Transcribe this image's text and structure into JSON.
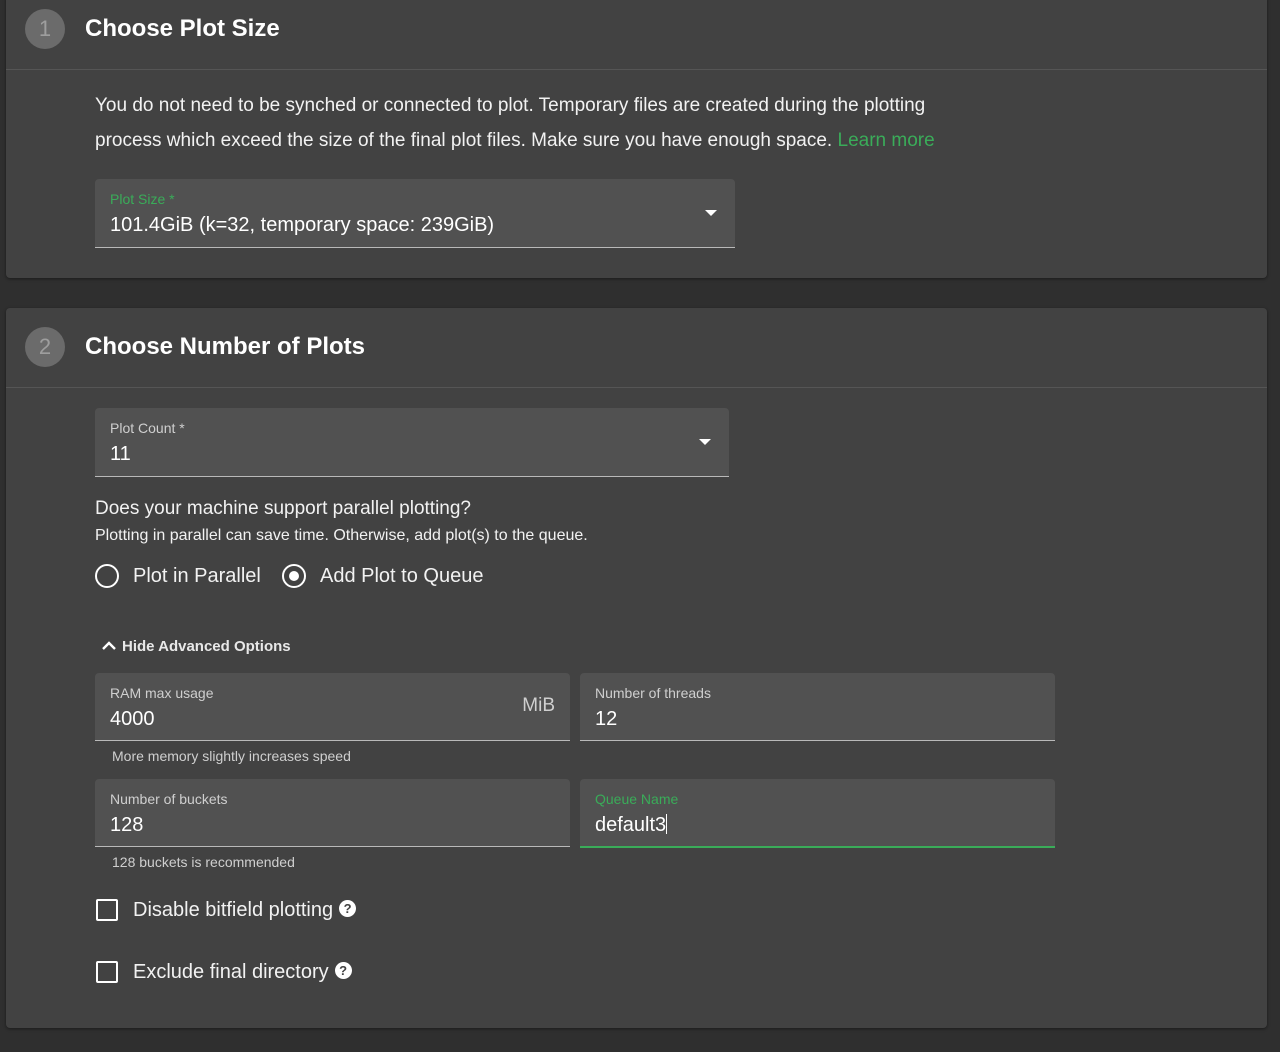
{
  "step1": {
    "number": "1",
    "title": "Choose Plot Size",
    "description": "You do not need to be synched or connected to plot. Temporary files are created during the plotting process which exceed the size of the final plot files. Make sure you have enough space.",
    "learn_more": "Learn more",
    "plot_size_label": "Plot Size *",
    "plot_size_value": "101.4GiB (k=32, temporary space: 239GiB)"
  },
  "step2": {
    "number": "2",
    "title": "Choose Number of Plots",
    "plot_count_label": "Plot Count *",
    "plot_count_value": "11",
    "parallel_question": "Does your machine support parallel plotting?",
    "parallel_hint": "Plotting in parallel can save time. Otherwise, add plot(s) to the queue.",
    "options": [
      {
        "label": "Plot in Parallel",
        "selected": false
      },
      {
        "label": "Add Plot to Queue",
        "selected": true
      }
    ],
    "advanced_toggle": "Hide Advanced Options",
    "ram": {
      "label": "RAM max usage",
      "value": "4000",
      "unit": "MiB",
      "helper": "More memory slightly increases speed"
    },
    "threads": {
      "label": "Number of threads",
      "value": "12"
    },
    "buckets": {
      "label": "Number of buckets",
      "value": "128",
      "helper": "128 buckets is recommended"
    },
    "queue": {
      "label": "Queue Name",
      "value": "default3"
    },
    "disable_bitfield": {
      "label": "Disable bitfield plotting",
      "checked": false
    },
    "exclude_final": {
      "label": "Exclude final directory",
      "checked": false
    }
  },
  "colors": {
    "accent": "#3aac59",
    "background": "#2f2f2f",
    "card": "#424242",
    "field": "#515151"
  }
}
